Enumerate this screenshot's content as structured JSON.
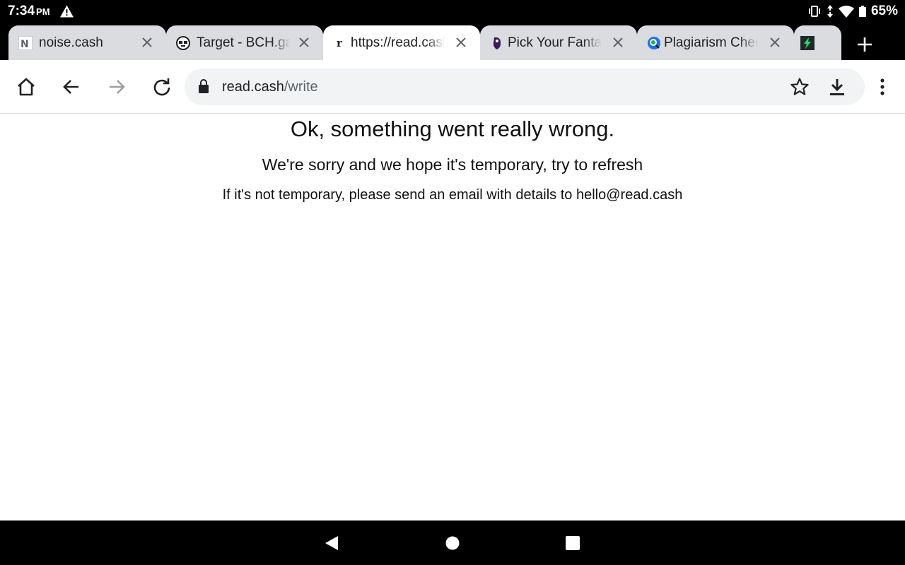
{
  "status_bar": {
    "time": "7:34",
    "ampm": "PM",
    "battery": "65%"
  },
  "tabs": [
    {
      "title": "noise.cash",
      "favicon": "noise-cash-favicon",
      "active": false
    },
    {
      "title": "Target - BCH.games",
      "favicon": "bch-games-favicon",
      "active": false
    },
    {
      "title": "https://read.cash",
      "favicon": "read-cash-favicon",
      "active": true
    },
    {
      "title": "Pick Your Fantasy",
      "favicon": "premier-league-favicon",
      "active": false
    },
    {
      "title": "Plagiarism Checker",
      "favicon": "plagiarism-favicon",
      "active": false
    },
    {
      "title": "",
      "favicon": "lightning-favicon",
      "active": false
    }
  ],
  "toolbar": {
    "url_domain": "read.cash",
    "url_path": "/write"
  },
  "page": {
    "title": "Ok, something went really wrong.",
    "subtitle": "We're sorry and we hope it's temporary, try to refresh",
    "note": "If it's not temporary, please send an email with details to hello@read.cash"
  },
  "colors": {
    "tab_inactive": "#dadce0",
    "tab_active": "#ffffff",
    "omnibox": "#f1f3f4",
    "icon": "#5f6368"
  }
}
